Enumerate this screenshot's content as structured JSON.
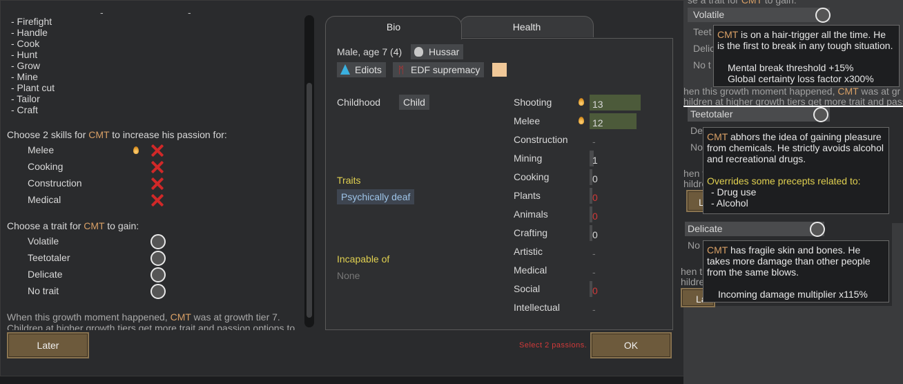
{
  "left": {
    "work_items": [
      "- Firefight",
      "- Handle",
      "- Cook",
      "- Hunt",
      "- Grow",
      "- Mine",
      "- Plant cut",
      "- Tailor",
      "- Craft"
    ],
    "passion_prompt": {
      "pre": "Choose 2 skills for ",
      "name": "CMT",
      "post": " to increase his passion for:"
    },
    "passion_skills": [
      "Melee",
      "Cooking",
      "Construction",
      "Medical"
    ],
    "trait_prompt": {
      "pre": "Choose a trait for ",
      "name": "CMT",
      "post": " to gain:"
    },
    "trait_options": [
      "Volatile",
      "Teetotaler",
      "Delicate",
      "No trait"
    ],
    "growth_note": {
      "pre": "When this growth moment happened, ",
      "name": "CMT",
      "post": " was at growth tier 7.",
      "line2": "Children at higher growth tiers get more trait and passion options to"
    },
    "later_label": "Later"
  },
  "tabs": {
    "bio": "Bio",
    "health": "Health"
  },
  "bio": {
    "summary": "Male, age 7 (4)",
    "faction": "Hussar",
    "ideo": "Ediots",
    "ideo2": "EDF supremacy",
    "childhood_label": "Childhood",
    "childhood_value": "Child",
    "traits_label": "Traits",
    "trait": "Psychically deaf",
    "incapable_label": "Incapable of",
    "incapable_value": "None"
  },
  "skills": [
    {
      "name": "Shooting",
      "value": "13",
      "passion": true,
      "level": 13,
      "color": "normal"
    },
    {
      "name": "Melee",
      "value": "12",
      "passion": true,
      "level": 12,
      "color": "normal"
    },
    {
      "name": "Construction",
      "value": "-",
      "passion": false,
      "level": 0,
      "color": "dash"
    },
    {
      "name": "Mining",
      "value": "1",
      "passion": false,
      "level": 1,
      "color": "normal"
    },
    {
      "name": "Cooking",
      "value": "0",
      "passion": false,
      "level": 0,
      "color": "normal"
    },
    {
      "name": "Plants",
      "value": "0",
      "passion": false,
      "level": 0,
      "color": "red"
    },
    {
      "name": "Animals",
      "value": "0",
      "passion": false,
      "level": 0,
      "color": "red"
    },
    {
      "name": "Crafting",
      "value": "0",
      "passion": false,
      "level": 0,
      "color": "normal"
    },
    {
      "name": "Artistic",
      "value": "-",
      "passion": false,
      "level": 0,
      "color": "dash"
    },
    {
      "name": "Medical",
      "value": "-",
      "passion": false,
      "level": 0,
      "color": "dash"
    },
    {
      "name": "Social",
      "value": "0",
      "passion": false,
      "level": 0,
      "color": "red"
    },
    {
      "name": "Intellectual",
      "value": "-",
      "passion": false,
      "level": 0,
      "color": "dash"
    }
  ],
  "footer": {
    "warning": "Select 2 passions.",
    "ok_label": "OK"
  },
  "right": {
    "opt1": "Volatile",
    "opt2": "Teetotaler",
    "opt3": "Delicate",
    "ghost_teetc": "Teet",
    "ghost_delic": "Delic",
    "ghost_not": "No t",
    "ghost_de": "De",
    "ghost_no": "No",
    "ghost_no2": "No t",
    "ghost_growth1": "hen this growth moment happened,",
    "ghost_growth1_name": "CMT",
    "ghost_growth1_post": "was at gr",
    "ghost_growth2": "hildren at higher growth tiers get more trait and pass",
    "ghost_growth3": "hen th",
    "ghost_growth4": "hildren",
    "ghost_growth5": "hen th",
    "ghost_growth6": "hildren",
    "ghost_top": "se a trait for",
    "ghost_top_name": "CMT",
    "ghost_top_post": "to gain:",
    "ghost_la1": "La",
    "ghost_la2": "La",
    "tooltip_volatile": {
      "name": "CMT",
      "line1_post": " is on a hair-trigger all the time. He",
      "line2": "is the first to break in any tough situation.",
      "stat1": "Mental break threshold +15%",
      "stat2": "Global certainty loss factor x300%"
    },
    "tooltip_teetotaler": {
      "name": "CMT",
      "line1_post": " abhors the idea of gaining pleasure",
      "line2": "from chemicals. He strictly avoids alcohol",
      "line3": "and recreational drugs.",
      "overrides": "Overrides some precepts related to:",
      "item1": "- Drug use",
      "item2": "- Alcohol"
    },
    "tooltip_delicate": {
      "name": "CMT",
      "line1_post": " has fragile skin and bones. He",
      "line2": "takes more damage than other people",
      "line3": "from the same blows.",
      "stat1": "Incoming damage multiplier x115%"
    }
  },
  "colors": {
    "accent": "#d9a066",
    "warning": "#d23a3a",
    "yellow": "#e0d050",
    "button": "#6d5a3c"
  }
}
